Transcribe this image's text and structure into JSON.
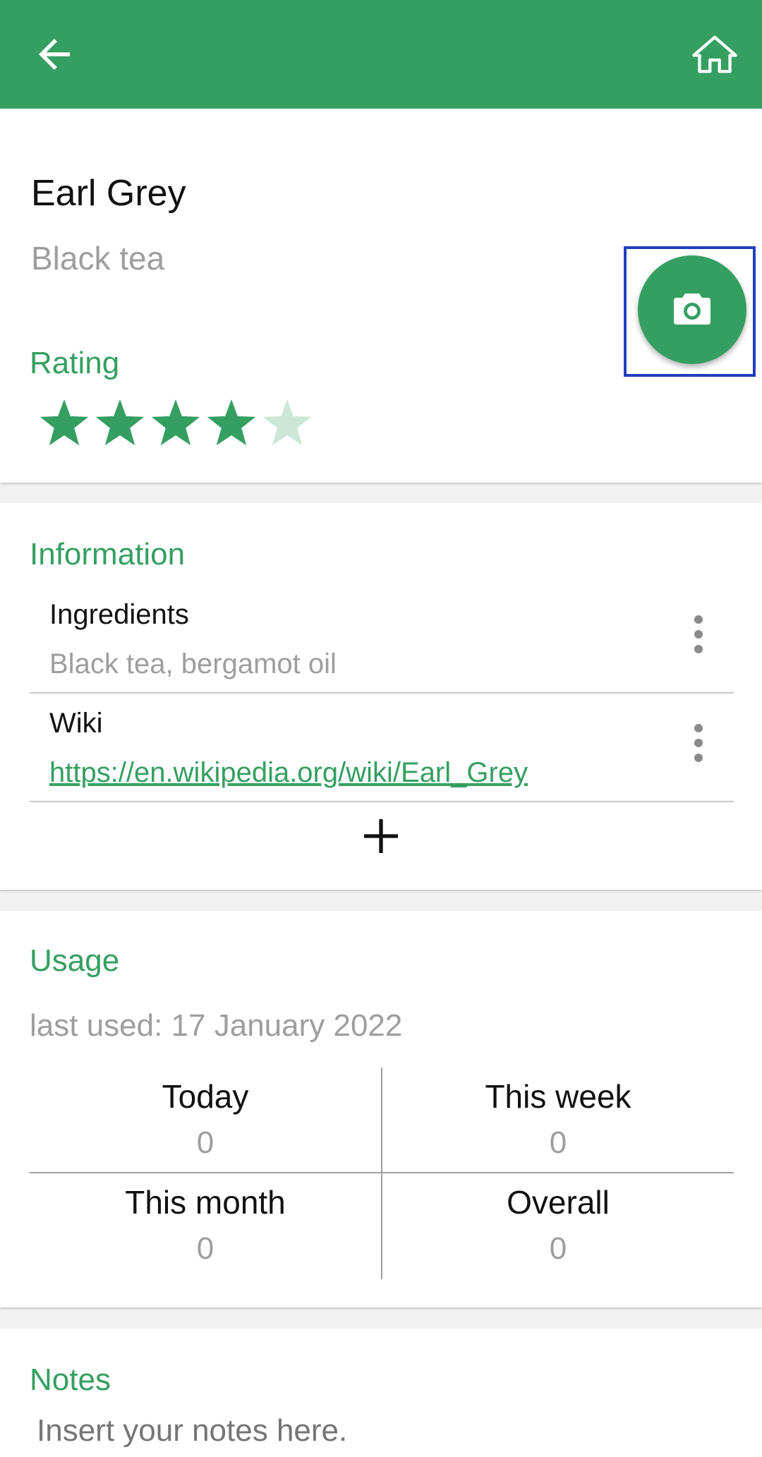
{
  "appbar": {
    "back_icon": "arrow-back-icon",
    "home_icon": "home-icon",
    "color": "#359f61"
  },
  "tea": {
    "name": "Earl Grey",
    "type": "Black tea"
  },
  "rating": {
    "label": "Rating",
    "value": 4,
    "max": 5,
    "color": "#359f61"
  },
  "information": {
    "label": "Information",
    "items": [
      {
        "title": "Ingredients",
        "value": "Black tea, bergamot oil"
      },
      {
        "title": "Wiki",
        "value": "https://en.wikipedia.org/wiki/Earl_Grey"
      }
    ]
  },
  "usage": {
    "label": "Usage",
    "last_used": "last used: 17 January 2022",
    "stats": [
      {
        "label": "Today",
        "value": "0"
      },
      {
        "label": "This week",
        "value": "0"
      },
      {
        "label": "This month",
        "value": "0"
      },
      {
        "label": "Overall",
        "value": "0"
      }
    ]
  },
  "notes": {
    "label": "Notes",
    "placeholder": "Insert your notes here."
  }
}
